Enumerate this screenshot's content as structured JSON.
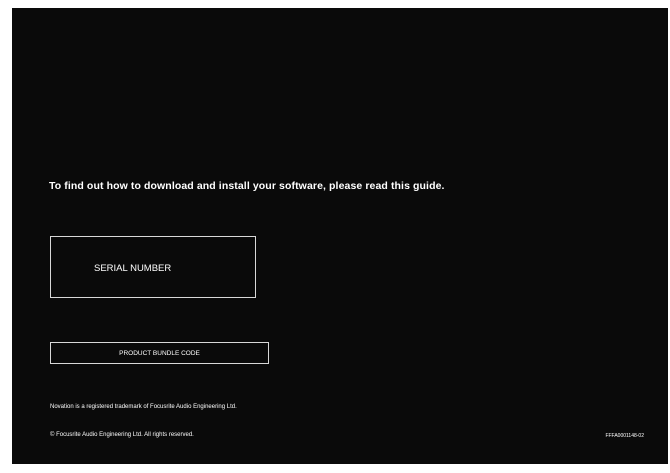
{
  "card": {
    "headline": "To find out how to download and install your software, please read this guide.",
    "serial_label": "SERIAL NUMBER",
    "bundle_label": "PRODUCT BUNDLE CODE",
    "trademark": "Novation is a registered trademark of Focusrite Audio Engineering Ltd.",
    "copyright": "© Focusrite Audio Engineering Ltd. All rights reserved.",
    "doc_code": "FFFA0001148-02"
  },
  "colors": {
    "background": "#0a0a0a",
    "text": "#ffffff",
    "border": "#d8d8d8"
  }
}
